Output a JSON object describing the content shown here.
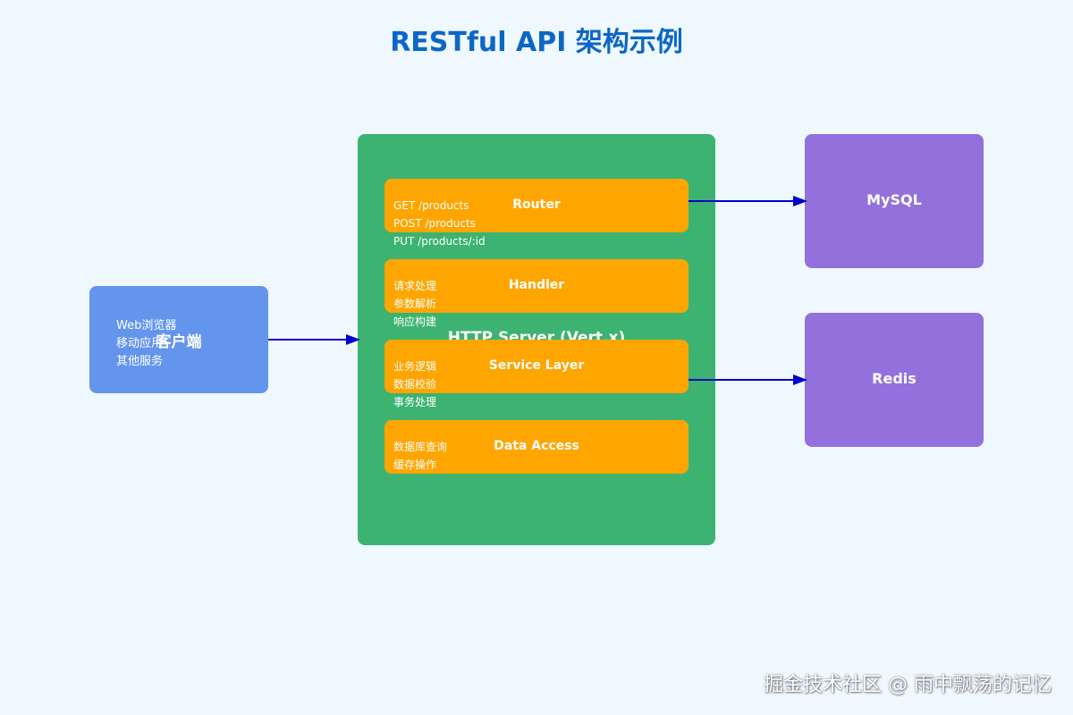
{
  "title": "RESTful API 架构示例",
  "colors": {
    "background": "#f0f8ff",
    "title": "#0b67c6",
    "client": "#6495ed",
    "server": "#3cb371",
    "layer": "#ffa500",
    "datastore": "#9370db",
    "arrow": "#0000cd"
  },
  "client": {
    "title": "客户端",
    "items": [
      "Web浏览器",
      "移动应用",
      "其他服务"
    ]
  },
  "server": {
    "title": "HTTP Server (Vert.x)",
    "layers": [
      {
        "title": "Router",
        "items": [
          "GET /products",
          "POST /products",
          "PUT /products/:id"
        ]
      },
      {
        "title": "Handler",
        "items": [
          "请求处理",
          "参数解析",
          "响应构建"
        ]
      },
      {
        "title": "Service Layer",
        "items": [
          "业务逻辑",
          "数据校验",
          "事务处理"
        ]
      },
      {
        "title": "Data Access",
        "items": [
          "数据库查询",
          "缓存操作"
        ]
      }
    ]
  },
  "datastores": [
    {
      "title": "MySQL"
    },
    {
      "title": "Redis"
    }
  ],
  "watermark": "掘金技术社区 @ 雨中飘荡的记忆"
}
